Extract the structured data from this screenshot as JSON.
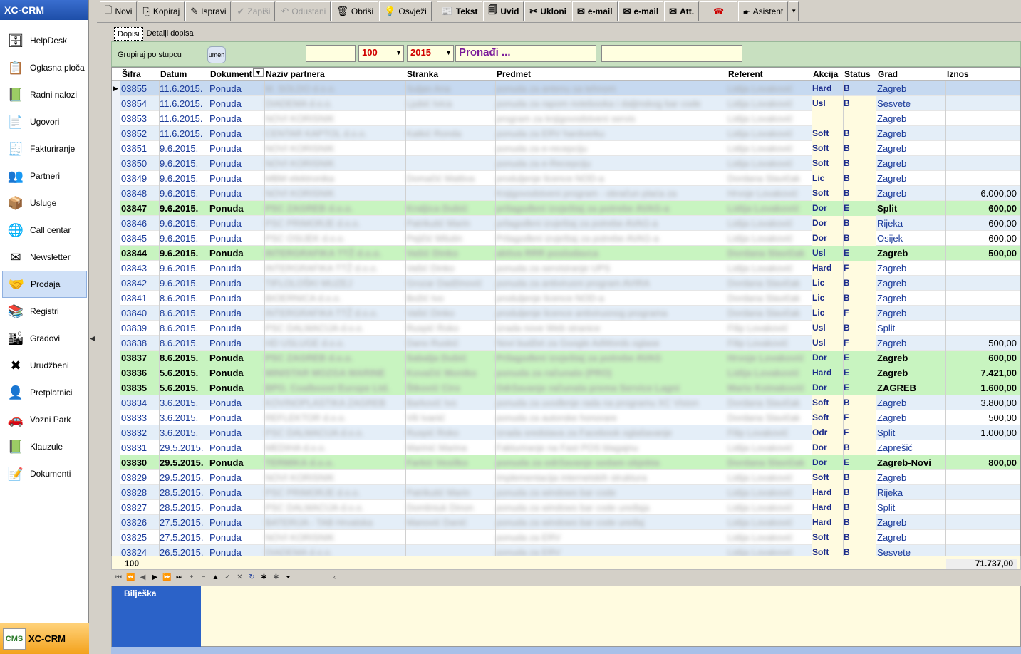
{
  "app": {
    "title": "XC-CRM"
  },
  "sidebar": {
    "items": [
      {
        "label": "HelpDesk",
        "icon": "helpdesk-icon",
        "glyph": "🗄"
      },
      {
        "label": "Oglasna ploča",
        "icon": "bulletin-board-icon",
        "glyph": "📋"
      },
      {
        "label": "Radni nalozi",
        "icon": "work-orders-icon",
        "glyph": "📗"
      },
      {
        "label": "Ugovori",
        "icon": "contracts-icon",
        "glyph": "📄"
      },
      {
        "label": "Fakturiranje",
        "icon": "invoicing-icon",
        "glyph": "🧾"
      },
      {
        "label": "Partneri",
        "icon": "partners-icon",
        "glyph": "👥"
      },
      {
        "label": "Usluge",
        "icon": "services-icon",
        "glyph": "📦"
      },
      {
        "label": "Call centar",
        "icon": "call-center-icon",
        "glyph": "🌐"
      },
      {
        "label": "Newsletter",
        "icon": "newsletter-icon",
        "glyph": "✉"
      },
      {
        "label": "Prodaja",
        "icon": "sales-icon",
        "glyph": "🤝",
        "active": true
      },
      {
        "label": "Registri",
        "icon": "registers-icon",
        "glyph": "📚"
      },
      {
        "label": "Gradovi",
        "icon": "cities-icon",
        "glyph": "🏙"
      },
      {
        "label": "Urudžbeni",
        "icon": "registry-book-icon",
        "glyph": "✖"
      },
      {
        "label": "Pretplatnici",
        "icon": "subscribers-icon",
        "glyph": "👤"
      },
      {
        "label": "Vozni Park",
        "icon": "vehicle-fleet-icon",
        "glyph": "🚗"
      },
      {
        "label": "Klauzule",
        "icon": "clauses-icon",
        "glyph": "📗"
      },
      {
        "label": "Dokumenti",
        "icon": "documents-icon",
        "glyph": "📝"
      }
    ],
    "footer_label": "XC-CRM",
    "footer_logo": "CMS"
  },
  "toolbar": {
    "novi": "Novi",
    "kopiraj": "Kopiraj",
    "ispravi": "Ispravi",
    "zapisi": "Zapiši",
    "odustani": "Odustani",
    "obrisi": "Obriši",
    "osvjezi": "Osvježi",
    "tekst": "Tekst",
    "uvid": "Uvid",
    "ukloni": "Ukloni",
    "email1": "e-mail",
    "email2": "e-mail",
    "att": "Att.",
    "asistent": "Asistent"
  },
  "tabs": [
    "Dopisi",
    "Detalji dopisa"
  ],
  "filter": {
    "group_label": "Grupiraj po stupcu",
    "group_btn": "umen",
    "count": "100",
    "year": "2015",
    "search": "Pronađi ..."
  },
  "columns": [
    "Šifra",
    "Datum",
    "Dokument",
    "Naziv partnera",
    "Stranka",
    "Predmet",
    "Referent",
    "Akcija",
    "Status",
    "Grad",
    "Iznos"
  ],
  "rows": [
    {
      "sifra": "03855",
      "datum": "11.6.2015.",
      "dok": "Ponuda",
      "partner": "M. SOLDO d.o.o.",
      "stranka": "Suljan Ana",
      "predmet": "ponuda za antenu sa tehnom",
      "ref": "Lidija Lovaković",
      "akcija": "Hard",
      "status": "B",
      "grad": "Zagreb",
      "iznos": "",
      "type": "sel"
    },
    {
      "sifra": "03854",
      "datum": "11.6.2015.",
      "dok": "Ponuda",
      "partner": "DIADEMA d.o.o.",
      "stranka": "Ljubić Ivica",
      "predmet": "ponuda za rapom notebooka i daljinskog bar code",
      "ref": "Lidija Lovaković",
      "akcija": "Usl",
      "status": "B",
      "grad": "Sesvete",
      "iznos": ""
    },
    {
      "sifra": "03853",
      "datum": "11.6.2015.",
      "dok": "Ponuda",
      "partner": "NOVI KORISNIK",
      "stranka": "",
      "predmet": "program za knjigovodstveni servis",
      "ref": "Lidija Lovaković",
      "akcija": "",
      "status": "",
      "grad": "Zagreb",
      "iznos": ""
    },
    {
      "sifra": "03852",
      "datum": "11.6.2015.",
      "dok": "Ponuda",
      "partner": "CENTAR KAPTOL d.o.o.",
      "stranka": "Katkić Ronda",
      "predmet": "ponuda za ERV hardverku",
      "ref": "Lidija Lovaković",
      "akcija": "Soft",
      "status": "B",
      "grad": "Zagreb",
      "iznos": ""
    },
    {
      "sifra": "03851",
      "datum": "9.6.2015.",
      "dok": "Ponuda",
      "partner": "NOVI KORISNIK",
      "stranka": "",
      "predmet": "ponuda za e-recepciju",
      "ref": "Lidija Lovaković",
      "akcija": "Soft",
      "status": "B",
      "grad": "Zagreb",
      "iznos": ""
    },
    {
      "sifra": "03850",
      "datum": "9.6.2015.",
      "dok": "Ponuda",
      "partner": "NOVI KORISNIK",
      "stranka": "",
      "predmet": "ponuda za e-Recepciju",
      "ref": "Lidija Lovaković",
      "akcija": "Soft",
      "status": "B",
      "grad": "Zagreb",
      "iznos": ""
    },
    {
      "sifra": "03849",
      "datum": "9.6.2015.",
      "dok": "Ponuda",
      "partner": "MBM elektronika",
      "stranka": "Domačić Mattiva",
      "predmet": "produljenje licence NOD-a",
      "ref": "Dordana Slavičak",
      "akcija": "Lic",
      "status": "B",
      "grad": "Zagreb",
      "iznos": ""
    },
    {
      "sifra": "03848",
      "datum": "9.6.2015.",
      "dok": "Ponuda",
      "partner": "NOVI KORISNIK",
      "stranka": "",
      "predmet": "Knjigovodstveni program - obračun plaća za",
      "ref": "Hrvoje Lovaković",
      "akcija": "Soft",
      "status": "B",
      "grad": "Zagreb",
      "iznos": "6.000,00"
    },
    {
      "sifra": "03847",
      "datum": "9.6.2015.",
      "dok": "Ponuda",
      "partner": "PSC ZAGREB d.o.o.",
      "stranka": "Kraljica Dubić",
      "predmet": "prilagođeni izvještaj za potrebe AVAG-a",
      "ref": "Lidija Lovaković",
      "akcija": "Dor",
      "status": "E",
      "grad": "Split",
      "iznos": "600,00",
      "type": "hl"
    },
    {
      "sifra": "03846",
      "datum": "9.6.2015.",
      "dok": "Ponuda",
      "partner": "PSC PRIMORJE d.o.o.",
      "stranka": "Patrikutić Marin",
      "predmet": "prilagođeni izvještaj za potrebe AVAG-a",
      "ref": "Lidija Lovaković",
      "akcija": "Dor",
      "status": "B",
      "grad": "Rijeka",
      "iznos": "600,00"
    },
    {
      "sifra": "03845",
      "datum": "9.6.2015.",
      "dok": "Ponuda",
      "partner": "PSC OSIJEK d.o.o.",
      "stranka": "Pejičić Milutin",
      "predmet": "Prilagođeni izvještaj za potrebe AVAG-a",
      "ref": "Lidija Lovaković",
      "akcija": "Dor",
      "status": "B",
      "grad": "Osijek",
      "iznos": "600,00"
    },
    {
      "sifra": "03844",
      "datum": "9.6.2015.",
      "dok": "Ponuda",
      "partner": "INTERGRAFIKA TTŽ d.o.o.",
      "stranka": "Vašić Dinko",
      "predmet": "aktiva RRR poslodavca",
      "ref": "Dordana Slavičak",
      "akcija": "Usl",
      "status": "E",
      "grad": "Zagreb",
      "iznos": "500,00",
      "type": "hl"
    },
    {
      "sifra": "03843",
      "datum": "9.6.2015.",
      "dok": "Ponuda",
      "partner": "INTERGRAFIKA TTŽ d.o.o.",
      "stranka": "Vašić Dinko",
      "predmet": "ponuda za servisiranje UPS",
      "ref": "Lidija Lovaković",
      "akcija": "Hard",
      "status": "F",
      "grad": "Zagreb",
      "iznos": ""
    },
    {
      "sifra": "03842",
      "datum": "9.6.2015.",
      "dok": "Ponuda",
      "partner": "TIFLOLOŠKI MUZEJ",
      "stranka": "Grozar Dadžinović",
      "predmet": "ponuda za antivirusni program AVIRA",
      "ref": "Dordana Slavičak",
      "akcija": "Lic",
      "status": "B",
      "grad": "Zagreb",
      "iznos": ""
    },
    {
      "sifra": "03841",
      "datum": "8.6.2015.",
      "dok": "Ponuda",
      "partner": "BIOERNICA d.o.o.",
      "stranka": "Božić Ivo",
      "predmet": "produljenje licence NOD-a",
      "ref": "Dordana Slavičak",
      "akcija": "Lic",
      "status": "B",
      "grad": "Zagreb",
      "iznos": ""
    },
    {
      "sifra": "03840",
      "datum": "8.6.2015.",
      "dok": "Ponuda",
      "partner": "INTERGRAFIKA TTŽ d.o.o.",
      "stranka": "Vašić Dinko",
      "predmet": "produljenje licence antivirusnog programa",
      "ref": "Dordana Slavičak",
      "akcija": "Lic",
      "status": "F",
      "grad": "Zagreb",
      "iznos": ""
    },
    {
      "sifra": "03839",
      "datum": "8.6.2015.",
      "dok": "Ponuda",
      "partner": "PSC DALMACIJA d.o.o.",
      "stranka": "Ruspić Roko",
      "predmet": "izrada nove Web stranice",
      "ref": "Filip Lovaković",
      "akcija": "Usl",
      "status": "B",
      "grad": "Split",
      "iznos": ""
    },
    {
      "sifra": "03838",
      "datum": "8.6.2015.",
      "dok": "Ponuda",
      "partner": "HD USLUGE d.o.o.",
      "stranka": "Dano Ruskić",
      "predmet": "Novi budžet za Google AdWords oglase",
      "ref": "Filip Lovaković",
      "akcija": "Usl",
      "status": "F",
      "grad": "Zagreb",
      "iznos": "500,00"
    },
    {
      "sifra": "03837",
      "datum": "8.6.2015.",
      "dok": "Ponuda",
      "partner": "PSC ZAGREB d.o.o.",
      "stranka": "Sabalja Dubić",
      "predmet": "Prilagođeni izvještaj za potrebe AVAG",
      "ref": "Hrvoje Lovaković",
      "akcija": "Dor",
      "status": "E",
      "grad": "Zagreb",
      "iznos": "600,00",
      "type": "hl"
    },
    {
      "sifra": "03836",
      "datum": "5.6.2015.",
      "dok": "Ponuda",
      "partner": "MINISTAR MOZGA MARINE",
      "stranka": "Kovačić Moniko",
      "predmet": "ponuda za računalo (PRO)",
      "ref": "Lidija Lovaković",
      "akcija": "Hard",
      "status": "E",
      "grad": "Zagreb",
      "iznos": "7.421,00",
      "type": "hl"
    },
    {
      "sifra": "03835",
      "datum": "5.6.2015.",
      "dok": "Ponuda",
      "partner": "BPO. Coalboost Europe Ltd.",
      "stranka": "Štković Ciro",
      "predmet": "Održavanje računala prema Service Lagni",
      "ref": "Mario Kotnaković",
      "akcija": "Dor",
      "status": "E",
      "grad": "ZAGREB",
      "iznos": "1.600,00",
      "type": "hl"
    },
    {
      "sifra": "03834",
      "datum": "3.6.2015.",
      "dok": "Ponuda",
      "partner": "KOVINOPLASTIKA ZAGREB",
      "stranka": "Barković Ivo",
      "predmet": "ponuda za uvođenje rada na programu XC Vision",
      "ref": "Dordana Slavičak",
      "akcija": "Soft",
      "status": "B",
      "grad": "Zagreb",
      "iznos": "3.800,00"
    },
    {
      "sifra": "03833",
      "datum": "3.6.2015.",
      "dok": "Ponuda",
      "partner": "REFLEKTOR d.o.o.",
      "stranka": "Vili Ivanić",
      "predmet": "ponuda za autorske honorare",
      "ref": "Dordana Slavičak",
      "akcija": "Soft",
      "status": "F",
      "grad": "Zagreb",
      "iznos": "500,00"
    },
    {
      "sifra": "03832",
      "datum": "3.6.2015.",
      "dok": "Ponuda",
      "partner": "PSC DALMACIJA d.o.o.",
      "stranka": "Ruspić Roko",
      "predmet": "Izrada sredstava za Facebook oglašavanje",
      "ref": "Filip Lovaković",
      "akcija": "Odr",
      "status": "F",
      "grad": "Split",
      "iznos": "1.000,00"
    },
    {
      "sifra": "03831",
      "datum": "29.5.2015.",
      "dok": "Ponuda",
      "partner": "MEDIHA d.o.o.",
      "stranka": "Marinić Marina",
      "predmet": "Fakturiranje na Fast POS blagajnu",
      "ref": "Lidija Lovaković",
      "akcija": "Dor",
      "status": "B",
      "grad": "Zaprešić",
      "iznos": ""
    },
    {
      "sifra": "03830",
      "datum": "29.5.2015.",
      "dok": "Ponuda",
      "partner": "TERMIKA d.o.o.",
      "stranka": "Farkić Vesilko",
      "predmet": "ponuda za održavanje sedam objekta",
      "ref": "Dordana Slavičak",
      "akcija": "Dor",
      "status": "E",
      "grad": "Zagreb-Novi",
      "iznos": "800,00",
      "type": "hl"
    },
    {
      "sifra": "03829",
      "datum": "29.5.2015.",
      "dok": "Ponuda",
      "partner": "NOVI KORISNIK",
      "stranka": "",
      "predmet": "Implementacija internetskih struktura",
      "ref": "Lidija Lovaković",
      "akcija": "Soft",
      "status": "B",
      "grad": "Zagreb",
      "iznos": ""
    },
    {
      "sifra": "03828",
      "datum": "28.5.2015.",
      "dok": "Ponuda",
      "partner": "PSC PRIMORJE d.o.o.",
      "stranka": "Patrikutić Marin",
      "predmet": "ponuda za windows bar code",
      "ref": "Lidija Lovaković",
      "akcija": "Hard",
      "status": "B",
      "grad": "Rijeka",
      "iznos": ""
    },
    {
      "sifra": "03827",
      "datum": "28.5.2015.",
      "dok": "Ponuda",
      "partner": "PSC DALMACIJA d.o.o.",
      "stranka": "Domliniuk Dinon",
      "predmet": "ponuda za windows bar code uređaja",
      "ref": "Lidija Lovaković",
      "akcija": "Hard",
      "status": "B",
      "grad": "Split",
      "iznos": ""
    },
    {
      "sifra": "03826",
      "datum": "27.5.2015.",
      "dok": "Ponuda",
      "partner": "BATERIJA - TAB Hrvatska",
      "stranka": "Manović Danić",
      "predmet": "ponuda za windows bar code uređaj",
      "ref": "Lidija Lovaković",
      "akcija": "Hard",
      "status": "B",
      "grad": "Zagreb",
      "iznos": ""
    },
    {
      "sifra": "03825",
      "datum": "27.5.2015.",
      "dok": "Ponuda",
      "partner": "NOVI KORISNIK",
      "stranka": "",
      "predmet": "ponuda za ERV",
      "ref": "Lidija Lovaković",
      "akcija": "Soft",
      "status": "B",
      "grad": "Zagreb",
      "iznos": ""
    },
    {
      "sifra": "03824",
      "datum": "26.5.2015.",
      "dok": "Ponuda",
      "partner": "DIADEMA d.o.o.",
      "stranka": "",
      "predmet": "ponuda za ERV",
      "ref": "Lidija Lovaković",
      "akcija": "Soft",
      "status": "B",
      "grad": "Sesvete",
      "iznos": ""
    }
  ],
  "footer": {
    "count": "100",
    "total": "71.737,00"
  },
  "notes": {
    "label": "Bilješka"
  },
  "colors": {
    "accent": "#2b62c8",
    "highlight_row": "#c8f4c0",
    "selected_row": "#c6d9f0",
    "note_bg": "#fffbe0",
    "search_text": "#7a1a9a",
    "filter_red": "#d00000"
  }
}
